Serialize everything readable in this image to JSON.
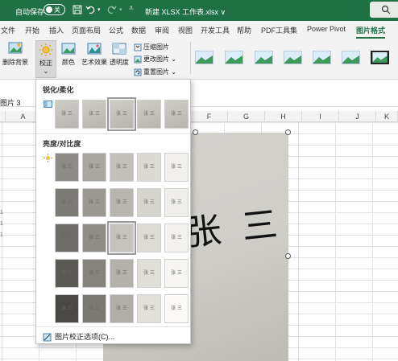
{
  "colors": {
    "brand": "#1f7145",
    "ribbon": "#f3f3f3"
  },
  "titlebar": {
    "autosave_label": "自动保存",
    "autosave_state": "关",
    "document_title": "新建 XLSX 工作表.xlsx ∨",
    "icons": [
      "save-icon",
      "undo-icon",
      "redo-icon",
      "search-icon"
    ]
  },
  "tabs": [
    "文件",
    "开始",
    "插入",
    "页面布局",
    "公式",
    "数据",
    "审阅",
    "视图",
    "开发工具",
    "帮助",
    "PDF工具集",
    "Power Pivot",
    "图片格式"
  ],
  "ribbon": {
    "remove_bg": "删除背景",
    "corrections": "校正",
    "color": "颜色",
    "artistic": "艺术效果",
    "transparency": "透明度",
    "compress": "压缩图片",
    "change": "更改图片",
    "reset": "重置图片"
  },
  "namebox": "图片 3",
  "columns": [
    "A",
    "F",
    "G",
    "H",
    "I",
    "J",
    "K"
  ],
  "dropdown": {
    "sharpen_title": "锐化/柔化",
    "brightness_title": "亮度/对比度",
    "thumb_label": "张 三",
    "footer": "图片校正选项(C)..."
  },
  "signature_text": "张 三"
}
